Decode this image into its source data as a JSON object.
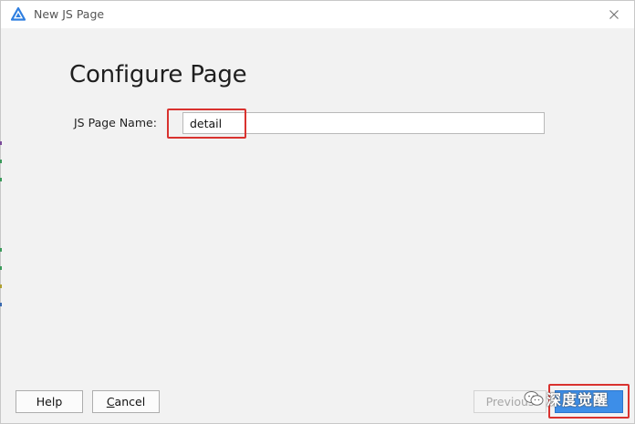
{
  "window": {
    "title": "New JS Page"
  },
  "page": {
    "heading": "Configure Page",
    "field_label": "JS Page Name:",
    "field_value": "detail"
  },
  "buttons": {
    "help": "Help",
    "cancel_mnemonic": "C",
    "cancel_rest": "ancel",
    "previous": "Previous"
  },
  "watermark": {
    "text": "深度觉醒"
  },
  "colors": {
    "accent": "#3d8ee8",
    "highlight": "#d9322f",
    "app_icon": "#2f7fe0"
  },
  "icons": {
    "app": "harmony-app-icon",
    "close": "close-icon",
    "watermark": "wechat-icon"
  }
}
